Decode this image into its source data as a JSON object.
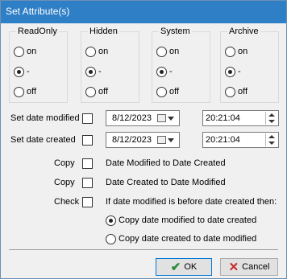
{
  "window": {
    "title": "Set Attribute(s)"
  },
  "groups": [
    {
      "title": "ReadOnly",
      "options": [
        "on",
        "-",
        "off"
      ],
      "selected": 1
    },
    {
      "title": "Hidden",
      "options": [
        "on",
        "-",
        "off"
      ],
      "selected": 1
    },
    {
      "title": "System",
      "options": [
        "on",
        "-",
        "off"
      ],
      "selected": 1
    },
    {
      "title": "Archive",
      "options": [
        "on",
        "-",
        "off"
      ],
      "selected": 1
    }
  ],
  "dates": {
    "modified": {
      "label": "Set date modified",
      "date": "8/12/2023",
      "time": "20:21:04",
      "checked": false
    },
    "created": {
      "label": "Set date created",
      "date": "8/12/2023",
      "time": "20:21:04",
      "checked": false
    }
  },
  "copy": {
    "copy1": {
      "label": "Copy",
      "text": "Date Modified to Date Created"
    },
    "copy2": {
      "label": "Copy",
      "text": "Date Created to Date Modified"
    },
    "check": {
      "label": "Check",
      "text": "If date modified is before date created then:"
    }
  },
  "options": {
    "opt1": "Copy date modified to date created",
    "opt2": "Copy date created to date modified",
    "selected": 0
  },
  "buttons": {
    "ok": "OK",
    "cancel": "Cancel"
  }
}
